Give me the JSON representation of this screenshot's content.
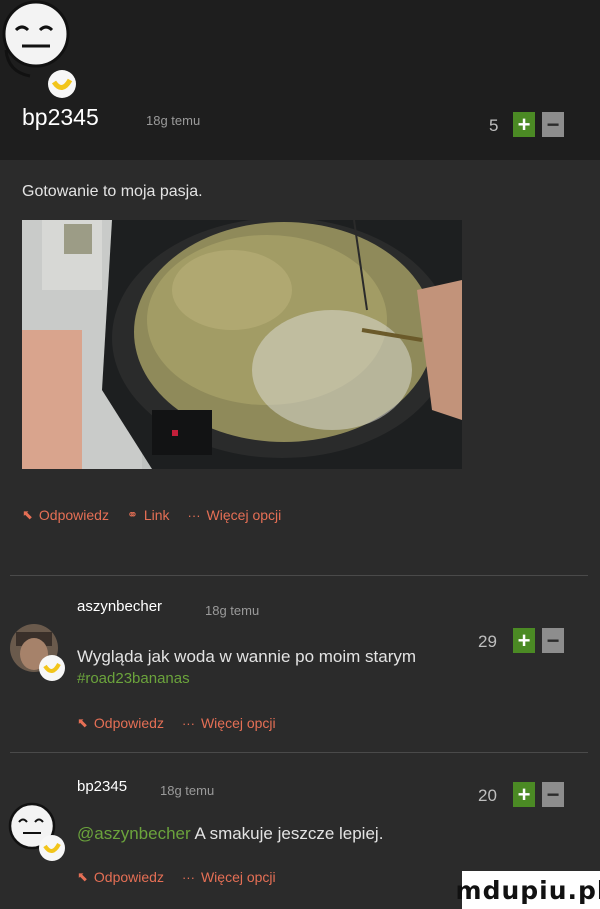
{
  "post": {
    "author": "bp2345",
    "time": "18g temu",
    "score": "5",
    "text": "Gotowanie to moja pasja.",
    "actions": {
      "reply": "Odpowiedz",
      "link": "Link",
      "more": "Więcej opcji"
    }
  },
  "comments": [
    {
      "author": "aszynbecher",
      "time": "18g temu",
      "score": "29",
      "text": "Wygląda jak woda w wannie po moim starym",
      "tag": "#road23bananas",
      "actions": {
        "reply": "Odpowiedz",
        "more": "Więcej opcji"
      }
    },
    {
      "author": "bp2345",
      "time": "18g temu",
      "score": "20",
      "mention": "@aszynbecher",
      "text": " A smakuje jeszcze lepiej.",
      "actions": {
        "reply": "Odpowiedz",
        "more": "Więcej opcji"
      }
    }
  ],
  "vote": {
    "plus": "+",
    "minus": "−"
  },
  "watermark": "mdupiu.pl",
  "colors": {
    "accent_action": "#e56f55",
    "vote_plus": "#4b8a24",
    "vote_minus": "#8d8d8d",
    "tag_green": "#6ba33c",
    "background": "#2b2b2b",
    "header_bg": "#1e1e1e"
  }
}
